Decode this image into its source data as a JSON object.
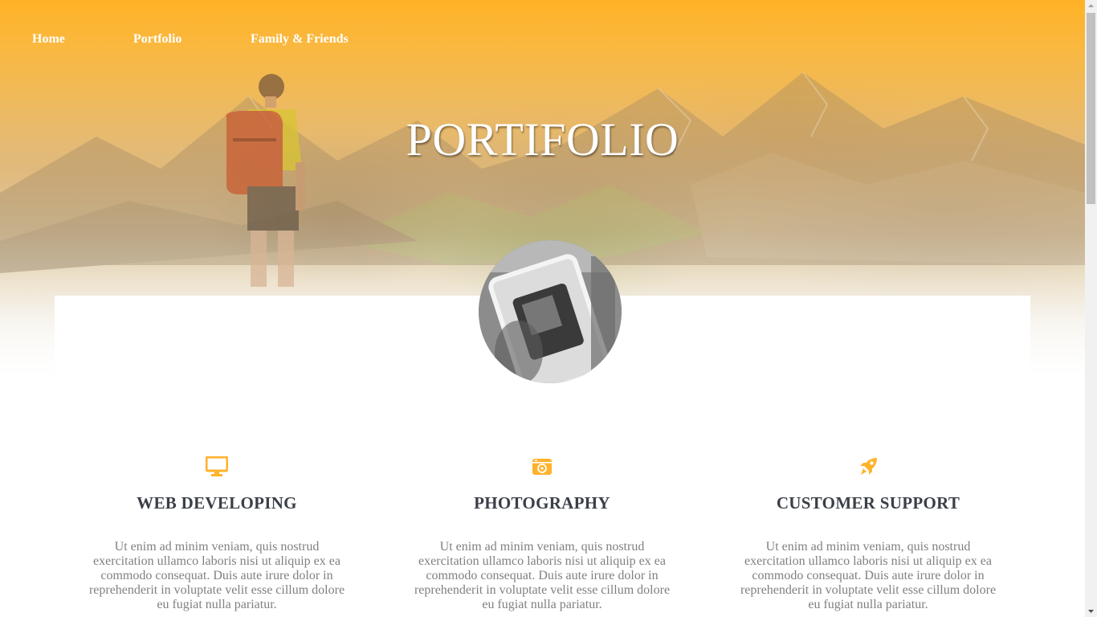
{
  "nav": {
    "items": [
      {
        "label": "Home"
      },
      {
        "label": "Portfolio"
      },
      {
        "label": "Family & Friends"
      }
    ]
  },
  "hero": {
    "title": "PORTIFOLIO"
  },
  "services": [
    {
      "icon": "monitor-icon",
      "title": "WEB DEVELOPING",
      "text": "Ut enim ad minim veniam, quis nostrud exercitation ullamco laboris nisi ut aliquip ex ea commodo consequat. Duis aute irure dolor in reprehenderit in voluptate velit esse cillum dolore eu fugiat nulla pariatur."
    },
    {
      "icon": "camera-icon",
      "title": "PHOTOGRAPHY",
      "text": "Ut enim ad minim veniam, quis nostrud exercitation ullamco laboris nisi ut aliquip ex ea commodo consequat. Duis aute irure dolor in reprehenderit in voluptate velit esse cillum dolore eu fugiat nulla pariatur."
    },
    {
      "icon": "rocket-icon",
      "title": "CUSTOMER SUPPORT",
      "text": "Ut enim ad minim veniam, quis nostrud exercitation ullamco laboris nisi ut aliquip ex ea commodo consequat. Duis aute irure dolor in reprehenderit in voluptate velit esse cillum dolore eu fugiat nulla pariatur."
    }
  ],
  "colors": {
    "accent": "#ffb22b",
    "heading": "#3a3f47",
    "body_text": "#808080"
  }
}
